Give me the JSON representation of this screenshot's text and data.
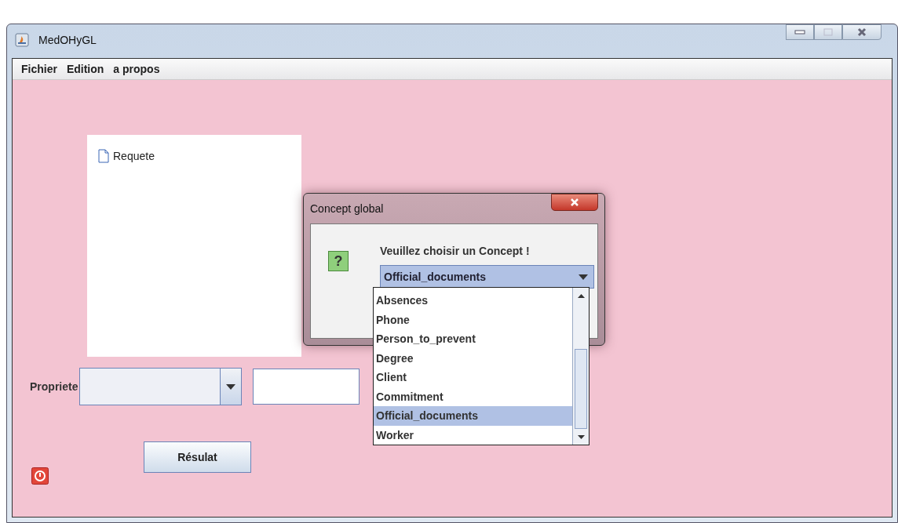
{
  "window": {
    "title": "MedOHyGL"
  },
  "menu": [
    {
      "label": "Fichier"
    },
    {
      "label": "Edition"
    },
    {
      "label": "a propos"
    }
  ],
  "tree": {
    "items": [
      {
        "label": "Requete"
      }
    ]
  },
  "property": {
    "label": "Propriete"
  },
  "result_button": {
    "label": "Résulat"
  },
  "dialog": {
    "title": "Concept global",
    "icon_glyph": "?",
    "message": "Veuillez choisir un Concept !",
    "combo": {
      "value": "Official_documents",
      "expanded": true
    },
    "options": [
      {
        "label": "Absences",
        "selected": false
      },
      {
        "label": "Phone",
        "selected": false
      },
      {
        "label": "Person_to_prevent",
        "selected": false
      },
      {
        "label": "Degree",
        "selected": false
      },
      {
        "label": "Client",
        "selected": false
      },
      {
        "label": "Commitment",
        "selected": false
      },
      {
        "label": "Official_documents",
        "selected": true
      },
      {
        "label": "Worker",
        "selected": false
      }
    ]
  }
}
